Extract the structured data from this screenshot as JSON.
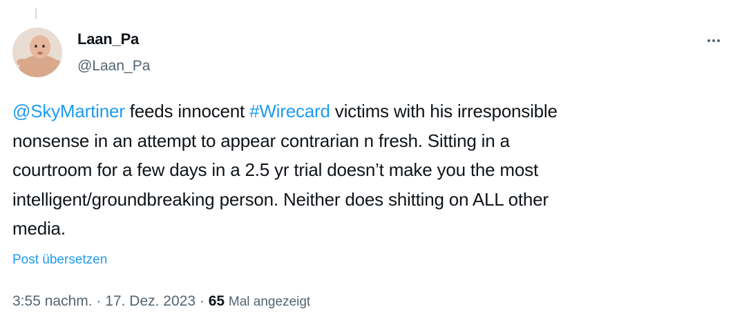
{
  "author": {
    "display_name": "Laan_Pa",
    "handle": "@Laan_Pa",
    "avatar_icon": "baby-photo-avatar"
  },
  "more_icon": "more-horizontal-icon",
  "tweet": {
    "mention": "@SkyMartiner",
    "text_1": " feeds innocent ",
    "hashtag": "#Wirecard",
    "text_2": " victims with his irresponsible",
    "line_2": "nonsense in an attempt to appear contrarian n fresh. Sitting in a",
    "line_3": "courtroom for a few days in a 2.5 yr trial doesn’t make you the most",
    "line_4": "intelligent/groundbreaking person. Neither does shitting on ALL other",
    "line_5": "media."
  },
  "translate_label": "Post übersetzen",
  "meta": {
    "time": "3:55 nachm.",
    "separator": " · ",
    "date": "17. Dez. 2023",
    "views_count": "65",
    "views_label": "Mal angezeigt"
  },
  "colors": {
    "link": "#1d9bf0",
    "text": "#0f1419",
    "secondary": "#536471"
  }
}
